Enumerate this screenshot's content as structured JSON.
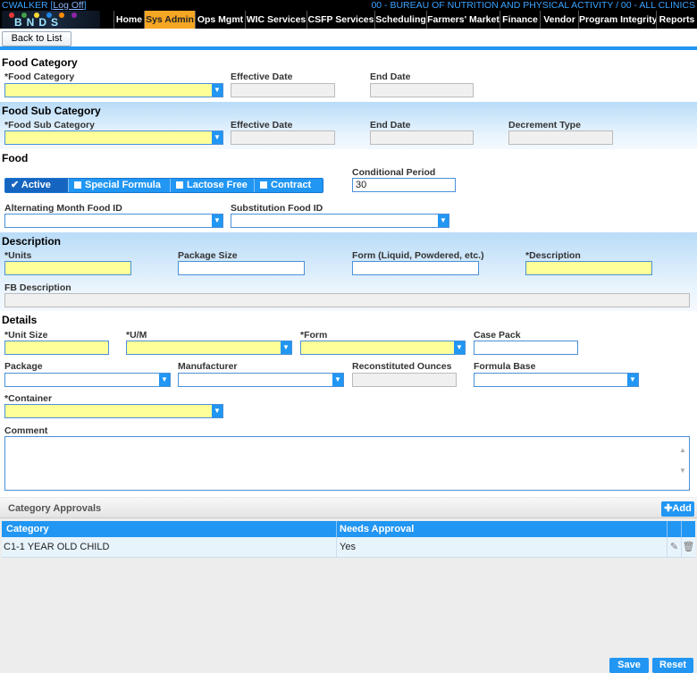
{
  "header": {
    "user": "CWALKER",
    "logoff": "Log Off",
    "agency": "00 - BUREAU OF NUTRITION AND PHYSICAL ACTIVITY / 00 - ALL CLINICS",
    "logo_text": "BNDS"
  },
  "nav": [
    "Home",
    "Sys Admin",
    "Ops Mgmt",
    "WIC Services",
    "CSFP Services",
    "Scheduling",
    "Farmers' Market",
    "Finance",
    "Vendor",
    "Program Integrity",
    "Reports"
  ],
  "nav_active": "Sys Admin",
  "toolbar": {
    "back_label": "Back to List"
  },
  "food_category": {
    "title": "Food Category",
    "category_label": "*Food Category",
    "effective_label": "Effective Date",
    "end_label": "End Date"
  },
  "food_sub_category": {
    "title": "Food Sub Category",
    "sub_label": "*Food Sub Category",
    "effective_label": "Effective Date",
    "end_label": "End Date",
    "decrement_label": "Decrement Type"
  },
  "food": {
    "title": "Food",
    "toggles": [
      "Active",
      "Special Formula",
      "Lactose Free",
      "Contract"
    ],
    "active_check": "✔",
    "conditional_label": "Conditional Period",
    "conditional_value": "30",
    "alt_label": "Alternating Month Food ID",
    "sub_label": "Substitution Food ID"
  },
  "description": {
    "title": "Description",
    "units_label": "*Units",
    "package_size_label": "Package Size",
    "form_label": "Form (Liquid, Powdered, etc.)",
    "description_label": "*Description",
    "fb_label": "FB Description"
  },
  "details": {
    "title": "Details",
    "unit_size_label": "*Unit Size",
    "um_label": "*U/M",
    "form_label": "*Form",
    "case_pack_label": "Case Pack",
    "package_label": "Package",
    "manufacturer_label": "Manufacturer",
    "recon_label": "Reconstituted Ounces",
    "formula_base_label": "Formula Base",
    "container_label": "*Container",
    "comment_label": "Comment"
  },
  "approvals": {
    "title": "Category Approvals",
    "add_label": "Add",
    "columns": [
      "Category",
      "Needs Approval"
    ],
    "rows": [
      {
        "category": "C1-1 YEAR OLD CHILD",
        "needs_approval": "Yes"
      }
    ]
  },
  "footer": {
    "save_label": "Save",
    "reset_label": "Reset"
  },
  "colors": {
    "accent": "#2196f3",
    "active_nav": "#f5a623",
    "required": "#ffff99"
  }
}
